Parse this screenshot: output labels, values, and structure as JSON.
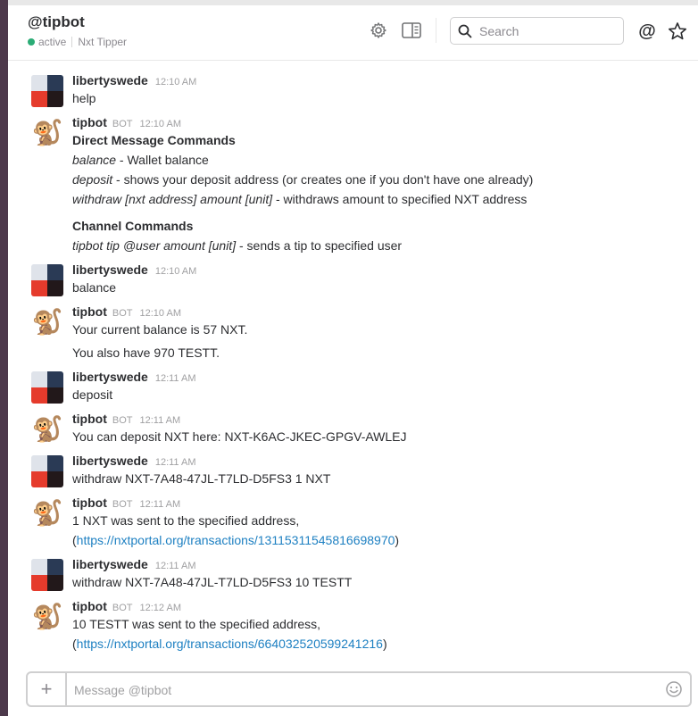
{
  "header": {
    "title": "@tipbot",
    "status": "active",
    "subtitle": "Nxt Tipper",
    "search_placeholder": "Search",
    "mention_symbol": "@"
  },
  "colors": {
    "sidebar": "#4d394b",
    "presence": "#2bac76",
    "link": "#1e80c2"
  },
  "avatars": {
    "bot_emoji": "🐒"
  },
  "messages": [
    {
      "sender": "libertyswede",
      "time": "12:10 AM",
      "text": "help"
    },
    {
      "sender": "tipbot",
      "bot_tag": "BOT",
      "time": "12:10 AM",
      "heading1": "Direct Message Commands",
      "cmd1_name": "balance",
      "cmd1_desc": " - Wallet balance",
      "cmd2_name": "deposit",
      "cmd2_desc": " - shows your deposit address (or creates one if you don't have one already)",
      "cmd3_name": "withdraw [nxt address] amount [unit]",
      "cmd3_desc": " - withdraws amount to specified NXT address",
      "heading2": "Channel Commands",
      "cmd4_name": "tipbot tip @user amount [unit]",
      "cmd4_desc": " - sends a tip to specified user"
    },
    {
      "sender": "libertyswede",
      "time": "12:10 AM",
      "text": "balance"
    },
    {
      "sender": "tipbot",
      "bot_tag": "BOT",
      "time": "12:10 AM",
      "text": "Your current balance is 57 NXT.",
      "text2": "You also have 970 TESTT."
    },
    {
      "sender": "libertyswede",
      "time": "12:11 AM",
      "text": "deposit"
    },
    {
      "sender": "tipbot",
      "bot_tag": "BOT",
      "time": "12:11 AM",
      "text": "You can deposit NXT here: NXT-K6AC-JKEC-GPGV-AWLEJ"
    },
    {
      "sender": "libertyswede",
      "time": "12:11 AM",
      "text": "withdraw NXT-7A48-47JL-T7LD-D5FS3 1 NXT"
    },
    {
      "sender": "tipbot",
      "bot_tag": "BOT",
      "time": "12:11 AM",
      "text": "1 NXT was sent to the specified address,",
      "paren_open": "(",
      "link": "https://nxtportal.org/transactions/13115311545816698970",
      "paren_close": ")"
    },
    {
      "sender": "libertyswede",
      "time": "12:11 AM",
      "text": "withdraw NXT-7A48-47JL-T7LD-D5FS3 10 TESTT"
    },
    {
      "sender": "tipbot",
      "bot_tag": "BOT",
      "time": "12:12 AM",
      "text": "10 TESTT was sent to the specified address,",
      "paren_open": "(",
      "link": "https://nxtportal.org/transactions/664032520599241216",
      "paren_close": ")"
    }
  ],
  "composer": {
    "plus": "+",
    "placeholder": "Message @tipbot"
  }
}
